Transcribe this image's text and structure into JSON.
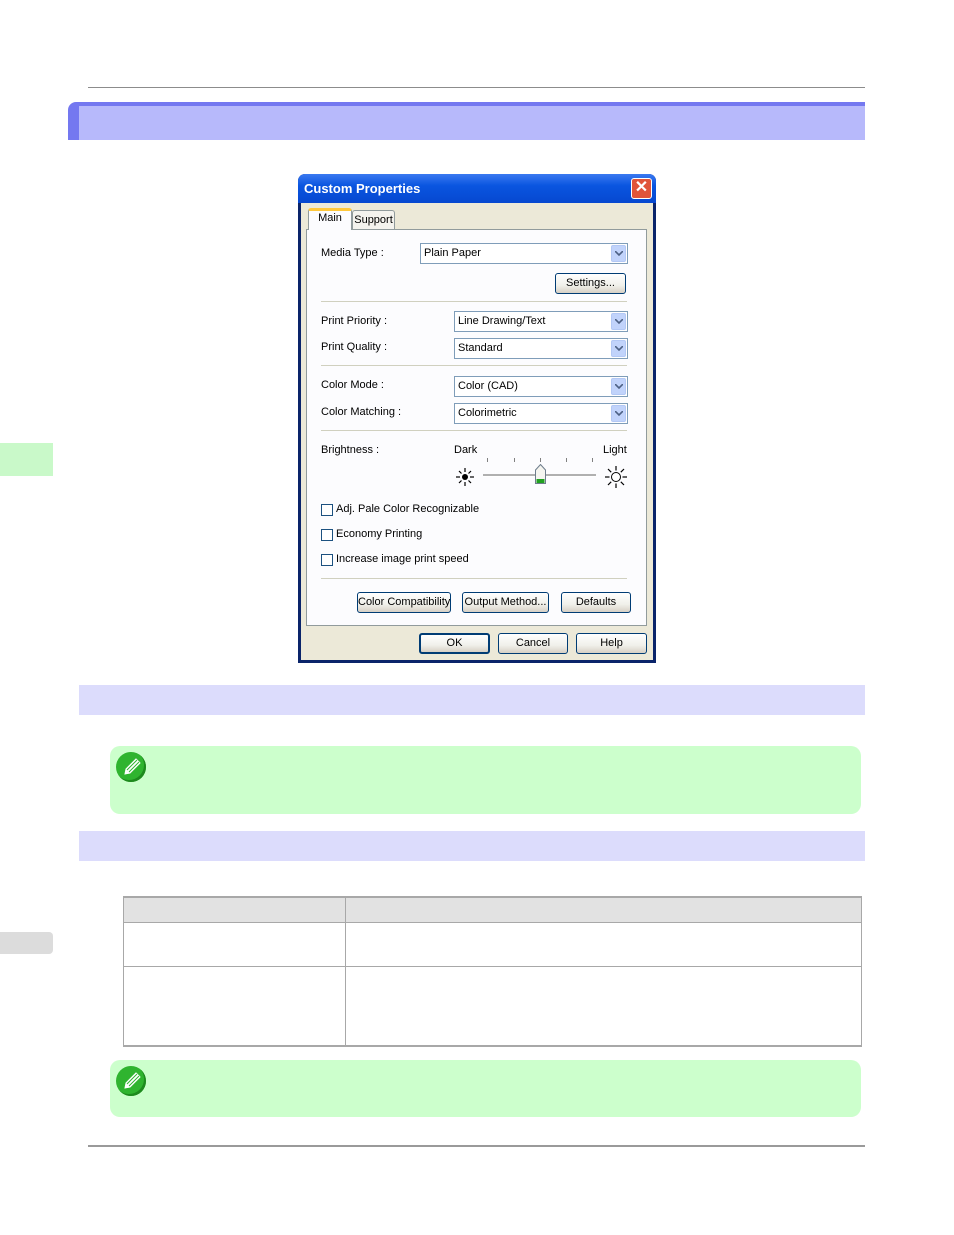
{
  "dialog": {
    "title": "Custom Properties",
    "close_glyph": "✕",
    "tabs": [
      {
        "label": "Main",
        "active": true
      },
      {
        "label": "Support",
        "active": false
      }
    ],
    "media_type": {
      "label": "Media Type :",
      "value": "Plain Paper"
    },
    "settings_button": "Settings...",
    "print_priority": {
      "label": "Print Priority :",
      "value": "Line Drawing/Text"
    },
    "print_quality": {
      "label": "Print Quality :",
      "value": "Standard"
    },
    "color_mode": {
      "label": "Color Mode :",
      "value": "Color (CAD)"
    },
    "color_matching": {
      "label": "Color Matching :",
      "value": "Colorimetric"
    },
    "brightness": {
      "label": "Brightness :",
      "dark_label": "Dark",
      "light_label": "Light",
      "level_fraction": 0.5
    },
    "checkboxes": [
      {
        "label": "Adj. Pale Color Recognizable",
        "checked": false
      },
      {
        "label": "Economy Printing",
        "checked": false
      },
      {
        "label": "Increase image print speed",
        "checked": false
      }
    ],
    "buttons": {
      "color_compatibility": "Color Compatibility",
      "output_method": "Output Method...",
      "defaults": "Defaults",
      "ok": "OK",
      "cancel": "Cancel",
      "help": "Help"
    }
  },
  "icons": {
    "note": "pencil-note-icon",
    "sun_dark": "sun-dark-icon",
    "sun_light": "sun-light-icon",
    "dropdown": "chevron-down-icon",
    "close": "close-icon"
  },
  "colors": {
    "chapter_banner": "#b7b9fb",
    "chapter_banner_border": "#7478f0",
    "section_band": "#dcdcfc",
    "note_bg": "#ccffcc",
    "side_tab": "#c9f9c9"
  },
  "table": {
    "headers": [
      "",
      ""
    ],
    "rows": [
      [
        "",
        ""
      ],
      [
        "",
        ""
      ]
    ]
  }
}
